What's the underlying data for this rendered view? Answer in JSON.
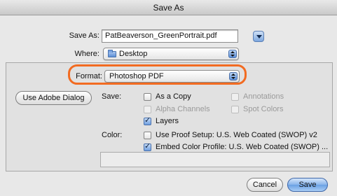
{
  "window": {
    "title": "Save As"
  },
  "save_as": {
    "label": "Save As:",
    "value": "PatBeaverson_GreenPortrait.pdf"
  },
  "where": {
    "label": "Where:",
    "value": "Desktop"
  },
  "format": {
    "label": "Format:",
    "value": "Photoshop PDF"
  },
  "buttons": {
    "use_adobe_dialog": "Use Adobe Dialog",
    "cancel": "Cancel",
    "save": "Save"
  },
  "save_options": {
    "label": "Save:",
    "as_a_copy": "As a Copy",
    "annotations": "Annotations",
    "alpha_channels": "Alpha Channels",
    "spot_colors": "Spot Colors",
    "layers": "Layers",
    "mark": "✓"
  },
  "color_options": {
    "label": "Color:",
    "use_proof_setup": "Use Proof Setup:  U.S. Web Coated (SWOP) v2",
    "embed_color_profile": "Embed Color Profile:  U.S. Web Coated (SWOP) ..."
  },
  "colors": {
    "highlight": "#f26b21",
    "accent": "#6aa0e3"
  }
}
